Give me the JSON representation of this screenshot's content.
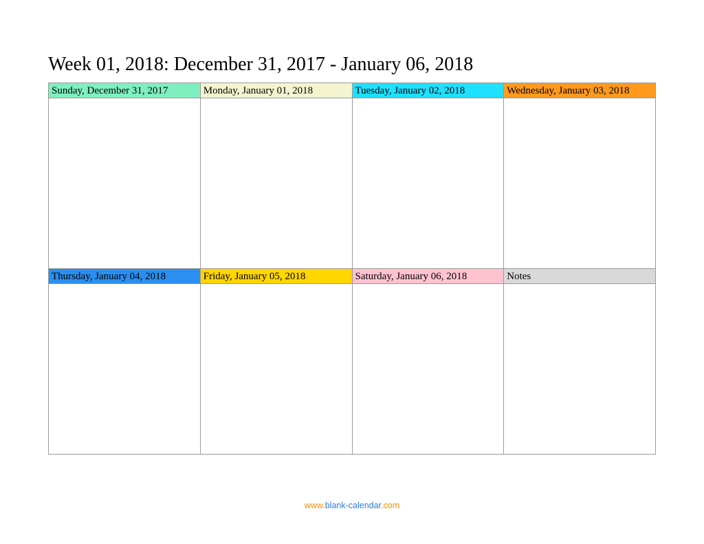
{
  "title": "Week 01, 2018: December 31, 2017 - January 06, 2018",
  "days": {
    "sun": {
      "label": "Sunday, December 31, 2017",
      "content": ""
    },
    "mon": {
      "label": "Monday, January 01, 2018",
      "content": ""
    },
    "tue": {
      "label": "Tuesday, January 02, 2018",
      "content": ""
    },
    "wed": {
      "label": "Wednesday, January 03, 2018",
      "content": ""
    },
    "thu": {
      "label": "Thursday, January 04, 2018",
      "content": ""
    },
    "fri": {
      "label": "Friday, January 05, 2018",
      "content": ""
    },
    "sat": {
      "label": "Saturday, January 06, 2018",
      "content": ""
    },
    "notes": {
      "label": "Notes",
      "content": ""
    }
  },
  "footer": {
    "p1": "www.",
    "p2": "blank-calendar",
    "p3": ".com"
  }
}
